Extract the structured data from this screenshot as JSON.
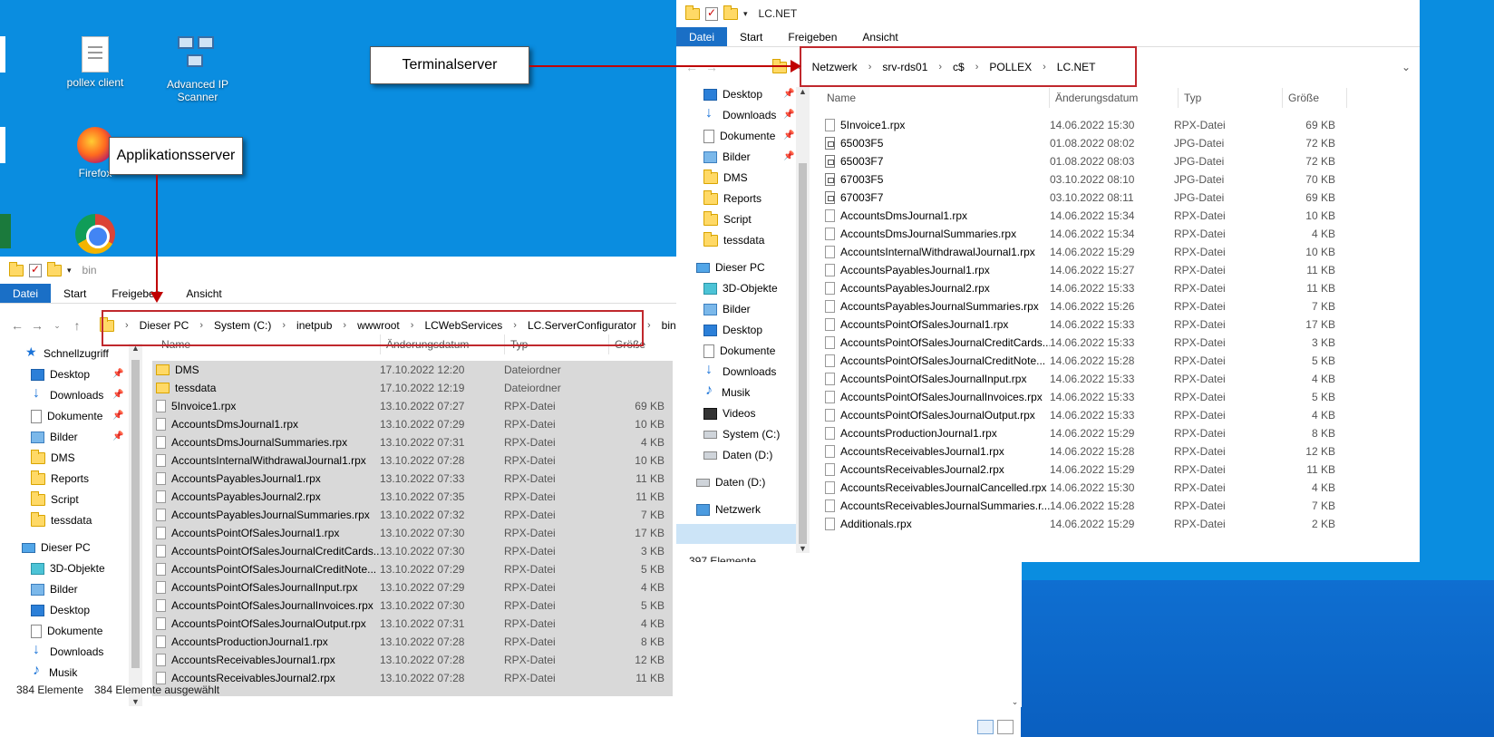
{
  "desktop": {
    "icons": [
      {
        "label": "pollex client",
        "icon": "document-icon"
      },
      {
        "label": "Advanced IP Scanner",
        "icon": "network-scanner-icon"
      },
      {
        "label": "Firefox",
        "icon": "firefox-icon"
      },
      {
        "label": "",
        "icon": "chrome-icon"
      }
    ]
  },
  "callouts": {
    "terminal": "Terminalserver",
    "app": "Applikationsserver"
  },
  "left_window": {
    "title": "bin",
    "ribbon": [
      "Datei",
      "Start",
      "Freigeben",
      "Ansicht"
    ],
    "breadcrumb": [
      "Dieser PC",
      "System (C:)",
      "inetpub",
      "wwwroot",
      "LCWebServices",
      "LC.ServerConfigurator",
      "bin"
    ],
    "nav": [
      {
        "label": "Schnellzugriff",
        "icon": "star"
      },
      {
        "label": "Desktop",
        "icon": "desk",
        "pin": true
      },
      {
        "label": "Downloads",
        "icon": "dl",
        "pin": true
      },
      {
        "label": "Dokumente",
        "icon": "doc",
        "pin": true
      },
      {
        "label": "Bilder",
        "icon": "pic",
        "pin": true
      },
      {
        "label": "DMS",
        "icon": "folder"
      },
      {
        "label": "Reports",
        "icon": "folder"
      },
      {
        "label": "Script",
        "icon": "folder"
      },
      {
        "label": "tessdata",
        "icon": "folder"
      },
      {
        "label": "Dieser PC",
        "icon": "pc"
      },
      {
        "label": "3D-Objekte",
        "icon": "obj"
      },
      {
        "label": "Bilder",
        "icon": "pic"
      },
      {
        "label": "Desktop",
        "icon": "desk"
      },
      {
        "label": "Dokumente",
        "icon": "doc"
      },
      {
        "label": "Downloads",
        "icon": "dl"
      },
      {
        "label": "Musik",
        "icon": "mus"
      }
    ],
    "columns": [
      "Name",
      "Änderungsdatum",
      "Typ",
      "Größe"
    ],
    "files": [
      {
        "name": "DMS",
        "date": "17.10.2022 12:20",
        "type": "Dateiordner",
        "size": "",
        "kind": "dir"
      },
      {
        "name": "tessdata",
        "date": "17.10.2022 12:19",
        "type": "Dateiordner",
        "size": "",
        "kind": "dir"
      },
      {
        "name": "5Invoice1.rpx",
        "date": "13.10.2022 07:27",
        "type": "RPX-Datei",
        "size": "69 KB",
        "kind": "file"
      },
      {
        "name": "AccountsDmsJournal1.rpx",
        "date": "13.10.2022 07:29",
        "type": "RPX-Datei",
        "size": "10 KB",
        "kind": "file"
      },
      {
        "name": "AccountsDmsJournalSummaries.rpx",
        "date": "13.10.2022 07:31",
        "type": "RPX-Datei",
        "size": "4 KB",
        "kind": "file"
      },
      {
        "name": "AccountsInternalWithdrawalJournal1.rpx",
        "date": "13.10.2022 07:28",
        "type": "RPX-Datei",
        "size": "10 KB",
        "kind": "file"
      },
      {
        "name": "AccountsPayablesJournal1.rpx",
        "date": "13.10.2022 07:33",
        "type": "RPX-Datei",
        "size": "11 KB",
        "kind": "file"
      },
      {
        "name": "AccountsPayablesJournal2.rpx",
        "date": "13.10.2022 07:35",
        "type": "RPX-Datei",
        "size": "11 KB",
        "kind": "file"
      },
      {
        "name": "AccountsPayablesJournalSummaries.rpx",
        "date": "13.10.2022 07:32",
        "type": "RPX-Datei",
        "size": "7 KB",
        "kind": "file"
      },
      {
        "name": "AccountsPointOfSalesJournal1.rpx",
        "date": "13.10.2022 07:30",
        "type": "RPX-Datei",
        "size": "17 KB",
        "kind": "file"
      },
      {
        "name": "AccountsPointOfSalesJournalCreditCards...",
        "date": "13.10.2022 07:30",
        "type": "RPX-Datei",
        "size": "3 KB",
        "kind": "file"
      },
      {
        "name": "AccountsPointOfSalesJournalCreditNote...",
        "date": "13.10.2022 07:29",
        "type": "RPX-Datei",
        "size": "5 KB",
        "kind": "file"
      },
      {
        "name": "AccountsPointOfSalesJournalInput.rpx",
        "date": "13.10.2022 07:29",
        "type": "RPX-Datei",
        "size": "4 KB",
        "kind": "file"
      },
      {
        "name": "AccountsPointOfSalesJournalInvoices.rpx",
        "date": "13.10.2022 07:30",
        "type": "RPX-Datei",
        "size": "5 KB",
        "kind": "file"
      },
      {
        "name": "AccountsPointOfSalesJournalOutput.rpx",
        "date": "13.10.2022 07:31",
        "type": "RPX-Datei",
        "size": "4 KB",
        "kind": "file"
      },
      {
        "name": "AccountsProductionJournal1.rpx",
        "date": "13.10.2022 07:28",
        "type": "RPX-Datei",
        "size": "8 KB",
        "kind": "file"
      },
      {
        "name": "AccountsReceivablesJournal1.rpx",
        "date": "13.10.2022 07:28",
        "type": "RPX-Datei",
        "size": "12 KB",
        "kind": "file"
      },
      {
        "name": "AccountsReceivablesJournal2.rpx",
        "date": "13.10.2022 07:28",
        "type": "RPX-Datei",
        "size": "11 KB",
        "kind": "file"
      }
    ],
    "status_count": "384 Elemente",
    "status_selected": "384 Elemente ausgewählt"
  },
  "right_window": {
    "title": "LC.NET",
    "ribbon": [
      "Datei",
      "Start",
      "Freigeben",
      "Ansicht"
    ],
    "breadcrumb": [
      "Netzwerk",
      "srv-rds01",
      "c$",
      "POLLEX",
      "LC.NET"
    ],
    "nav": [
      {
        "label": "Desktop",
        "icon": "desk",
        "pin": true
      },
      {
        "label": "Downloads",
        "icon": "dl",
        "pin": true
      },
      {
        "label": "Dokumente",
        "icon": "doc",
        "pin": true
      },
      {
        "label": "Bilder",
        "icon": "pic",
        "pin": true
      },
      {
        "label": "DMS",
        "icon": "folder"
      },
      {
        "label": "Reports",
        "icon": "folder"
      },
      {
        "label": "Script",
        "icon": "folder"
      },
      {
        "label": "tessdata",
        "icon": "folder"
      },
      {
        "label": "Dieser PC",
        "icon": "pc"
      },
      {
        "label": "3D-Objekte",
        "icon": "obj"
      },
      {
        "label": "Bilder",
        "icon": "pic"
      },
      {
        "label": "Desktop",
        "icon": "desk"
      },
      {
        "label": "Dokumente",
        "icon": "doc"
      },
      {
        "label": "Downloads",
        "icon": "dl"
      },
      {
        "label": "Musik",
        "icon": "mus"
      },
      {
        "label": "Videos",
        "icon": "vid"
      },
      {
        "label": "System (C:)",
        "icon": "drv"
      },
      {
        "label": "Daten (D:)",
        "icon": "drv"
      },
      {
        "label": "Daten (D:)",
        "icon": "drv"
      },
      {
        "label": "Netzwerk",
        "icon": "net"
      }
    ],
    "columns": [
      "Name",
      "Änderungsdatum",
      "Typ",
      "Größe"
    ],
    "files": [
      {
        "name": "5Invoice1.rpx",
        "date": "14.06.2022 15:30",
        "type": "RPX-Datei",
        "size": "69 KB",
        "kind": "file"
      },
      {
        "name": "65003F5",
        "date": "01.08.2022 08:02",
        "type": "JPG-Datei",
        "size": "72 KB",
        "kind": "jpg"
      },
      {
        "name": "65003F7",
        "date": "01.08.2022 08:03",
        "type": "JPG-Datei",
        "size": "72 KB",
        "kind": "jpg"
      },
      {
        "name": "67003F5",
        "date": "03.10.2022 08:10",
        "type": "JPG-Datei",
        "size": "70 KB",
        "kind": "jpg"
      },
      {
        "name": "67003F7",
        "date": "03.10.2022 08:11",
        "type": "JPG-Datei",
        "size": "69 KB",
        "kind": "jpg"
      },
      {
        "name": "AccountsDmsJournal1.rpx",
        "date": "14.06.2022 15:34",
        "type": "RPX-Datei",
        "size": "10 KB",
        "kind": "file"
      },
      {
        "name": "AccountsDmsJournalSummaries.rpx",
        "date": "14.06.2022 15:34",
        "type": "RPX-Datei",
        "size": "4 KB",
        "kind": "file"
      },
      {
        "name": "AccountsInternalWithdrawalJournal1.rpx",
        "date": "14.06.2022 15:29",
        "type": "RPX-Datei",
        "size": "10 KB",
        "kind": "file"
      },
      {
        "name": "AccountsPayablesJournal1.rpx",
        "date": "14.06.2022 15:27",
        "type": "RPX-Datei",
        "size": "11 KB",
        "kind": "file"
      },
      {
        "name": "AccountsPayablesJournal2.rpx",
        "date": "14.06.2022 15:33",
        "type": "RPX-Datei",
        "size": "11 KB",
        "kind": "file"
      },
      {
        "name": "AccountsPayablesJournalSummaries.rpx",
        "date": "14.06.2022 15:26",
        "type": "RPX-Datei",
        "size": "7 KB",
        "kind": "file"
      },
      {
        "name": "AccountsPointOfSalesJournal1.rpx",
        "date": "14.06.2022 15:33",
        "type": "RPX-Datei",
        "size": "17 KB",
        "kind": "file"
      },
      {
        "name": "AccountsPointOfSalesJournalCreditCards...",
        "date": "14.06.2022 15:33",
        "type": "RPX-Datei",
        "size": "3 KB",
        "kind": "file"
      },
      {
        "name": "AccountsPointOfSalesJournalCreditNote...",
        "date": "14.06.2022 15:28",
        "type": "RPX-Datei",
        "size": "5 KB",
        "kind": "file"
      },
      {
        "name": "AccountsPointOfSalesJournalInput.rpx",
        "date": "14.06.2022 15:33",
        "type": "RPX-Datei",
        "size": "4 KB",
        "kind": "file"
      },
      {
        "name": "AccountsPointOfSalesJournalInvoices.rpx",
        "date": "14.06.2022 15:33",
        "type": "RPX-Datei",
        "size": "5 KB",
        "kind": "file"
      },
      {
        "name": "AccountsPointOfSalesJournalOutput.rpx",
        "date": "14.06.2022 15:33",
        "type": "RPX-Datei",
        "size": "4 KB",
        "kind": "file"
      },
      {
        "name": "AccountsProductionJournal1.rpx",
        "date": "14.06.2022 15:29",
        "type": "RPX-Datei",
        "size": "8 KB",
        "kind": "file"
      },
      {
        "name": "AccountsReceivablesJournal1.rpx",
        "date": "14.06.2022 15:28",
        "type": "RPX-Datei",
        "size": "12 KB",
        "kind": "file"
      },
      {
        "name": "AccountsReceivablesJournal2.rpx",
        "date": "14.06.2022 15:29",
        "type": "RPX-Datei",
        "size": "11 KB",
        "kind": "file"
      },
      {
        "name": "AccountsReceivablesJournalCancelled.rpx",
        "date": "14.06.2022 15:30",
        "type": "RPX-Datei",
        "size": "4 KB",
        "kind": "file"
      },
      {
        "name": "AccountsReceivablesJournalSummaries.r...",
        "date": "14.06.2022 15:28",
        "type": "RPX-Datei",
        "size": "7 KB",
        "kind": "file"
      },
      {
        "name": "Additionals.rpx",
        "date": "14.06.2022 15:29",
        "type": "RPX-Datei",
        "size": "2 KB",
        "kind": "file"
      }
    ],
    "status_count": "397 Elemente"
  },
  "colors": {
    "desktop": "#0a8de0",
    "accent": "#1a6fc6",
    "annotation_red": "#c00000",
    "selection_grey": "#d9d9d9"
  }
}
